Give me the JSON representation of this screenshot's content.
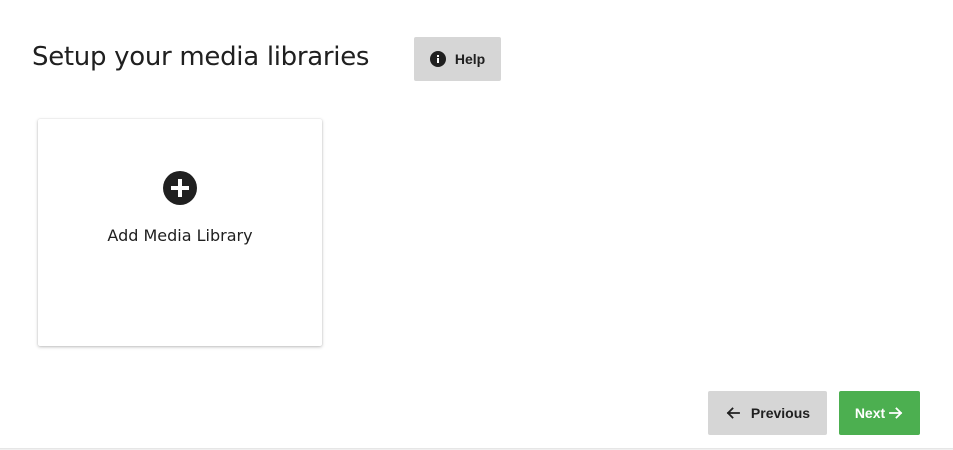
{
  "header": {
    "title": "Setup your media libraries",
    "help_label": "Help",
    "help_icon": "info-circle-icon"
  },
  "libraries": {
    "add_label": "Add Media Library",
    "add_icon": "plus-circle-icon"
  },
  "footer": {
    "previous_label": "Previous",
    "previous_icon": "arrow-left-icon",
    "next_label": "Next",
    "next_icon": "arrow-right-icon"
  },
  "colors": {
    "accent": "#4caf50",
    "button_gray": "#d6d6d6",
    "text": "#202020"
  }
}
